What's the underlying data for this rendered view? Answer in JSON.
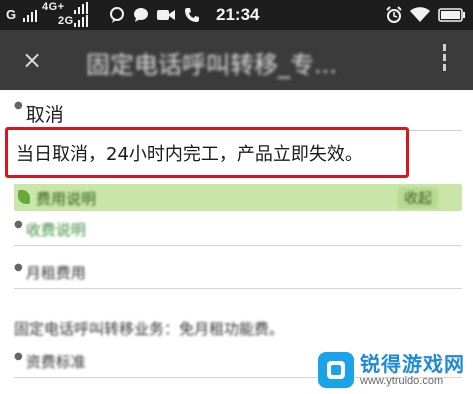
{
  "status_bar": {
    "carrier_1": "G",
    "network_top": "4G+",
    "network_bottom": "2G",
    "time": "21:34"
  },
  "title_bar": {
    "close_glyph": "×",
    "title": "固定电话呼叫转移_专...",
    "more_glyph": "⋮"
  },
  "content": {
    "heading": "取消",
    "notice": "当日取消，24小时内完工，产品立即失效。",
    "fee_bar_label": "费用说明",
    "fee_bar_button": "收起",
    "fee_link": "收费说明",
    "monthly_fee_label": "月租费用",
    "description": "固定电话呼叫转移业务：免月租功能费。",
    "standard_label": "资费标准"
  },
  "watermark": {
    "name": "锐得游戏网",
    "url": "www.ytruido.com"
  },
  "colors": {
    "status_bar_bg": "#1d1d1d",
    "title_bar_bg": "#3b3b3b",
    "highlight_border": "#d8171c",
    "green_bar_bg": "#c9e6a8",
    "link_green": "#3a8d3a"
  },
  "icons": [
    "signal-icon",
    "alarm-icon",
    "wifi-icon",
    "battery-icon",
    "chat-bubble-icon",
    "video-icon",
    "phone-icon"
  ]
}
